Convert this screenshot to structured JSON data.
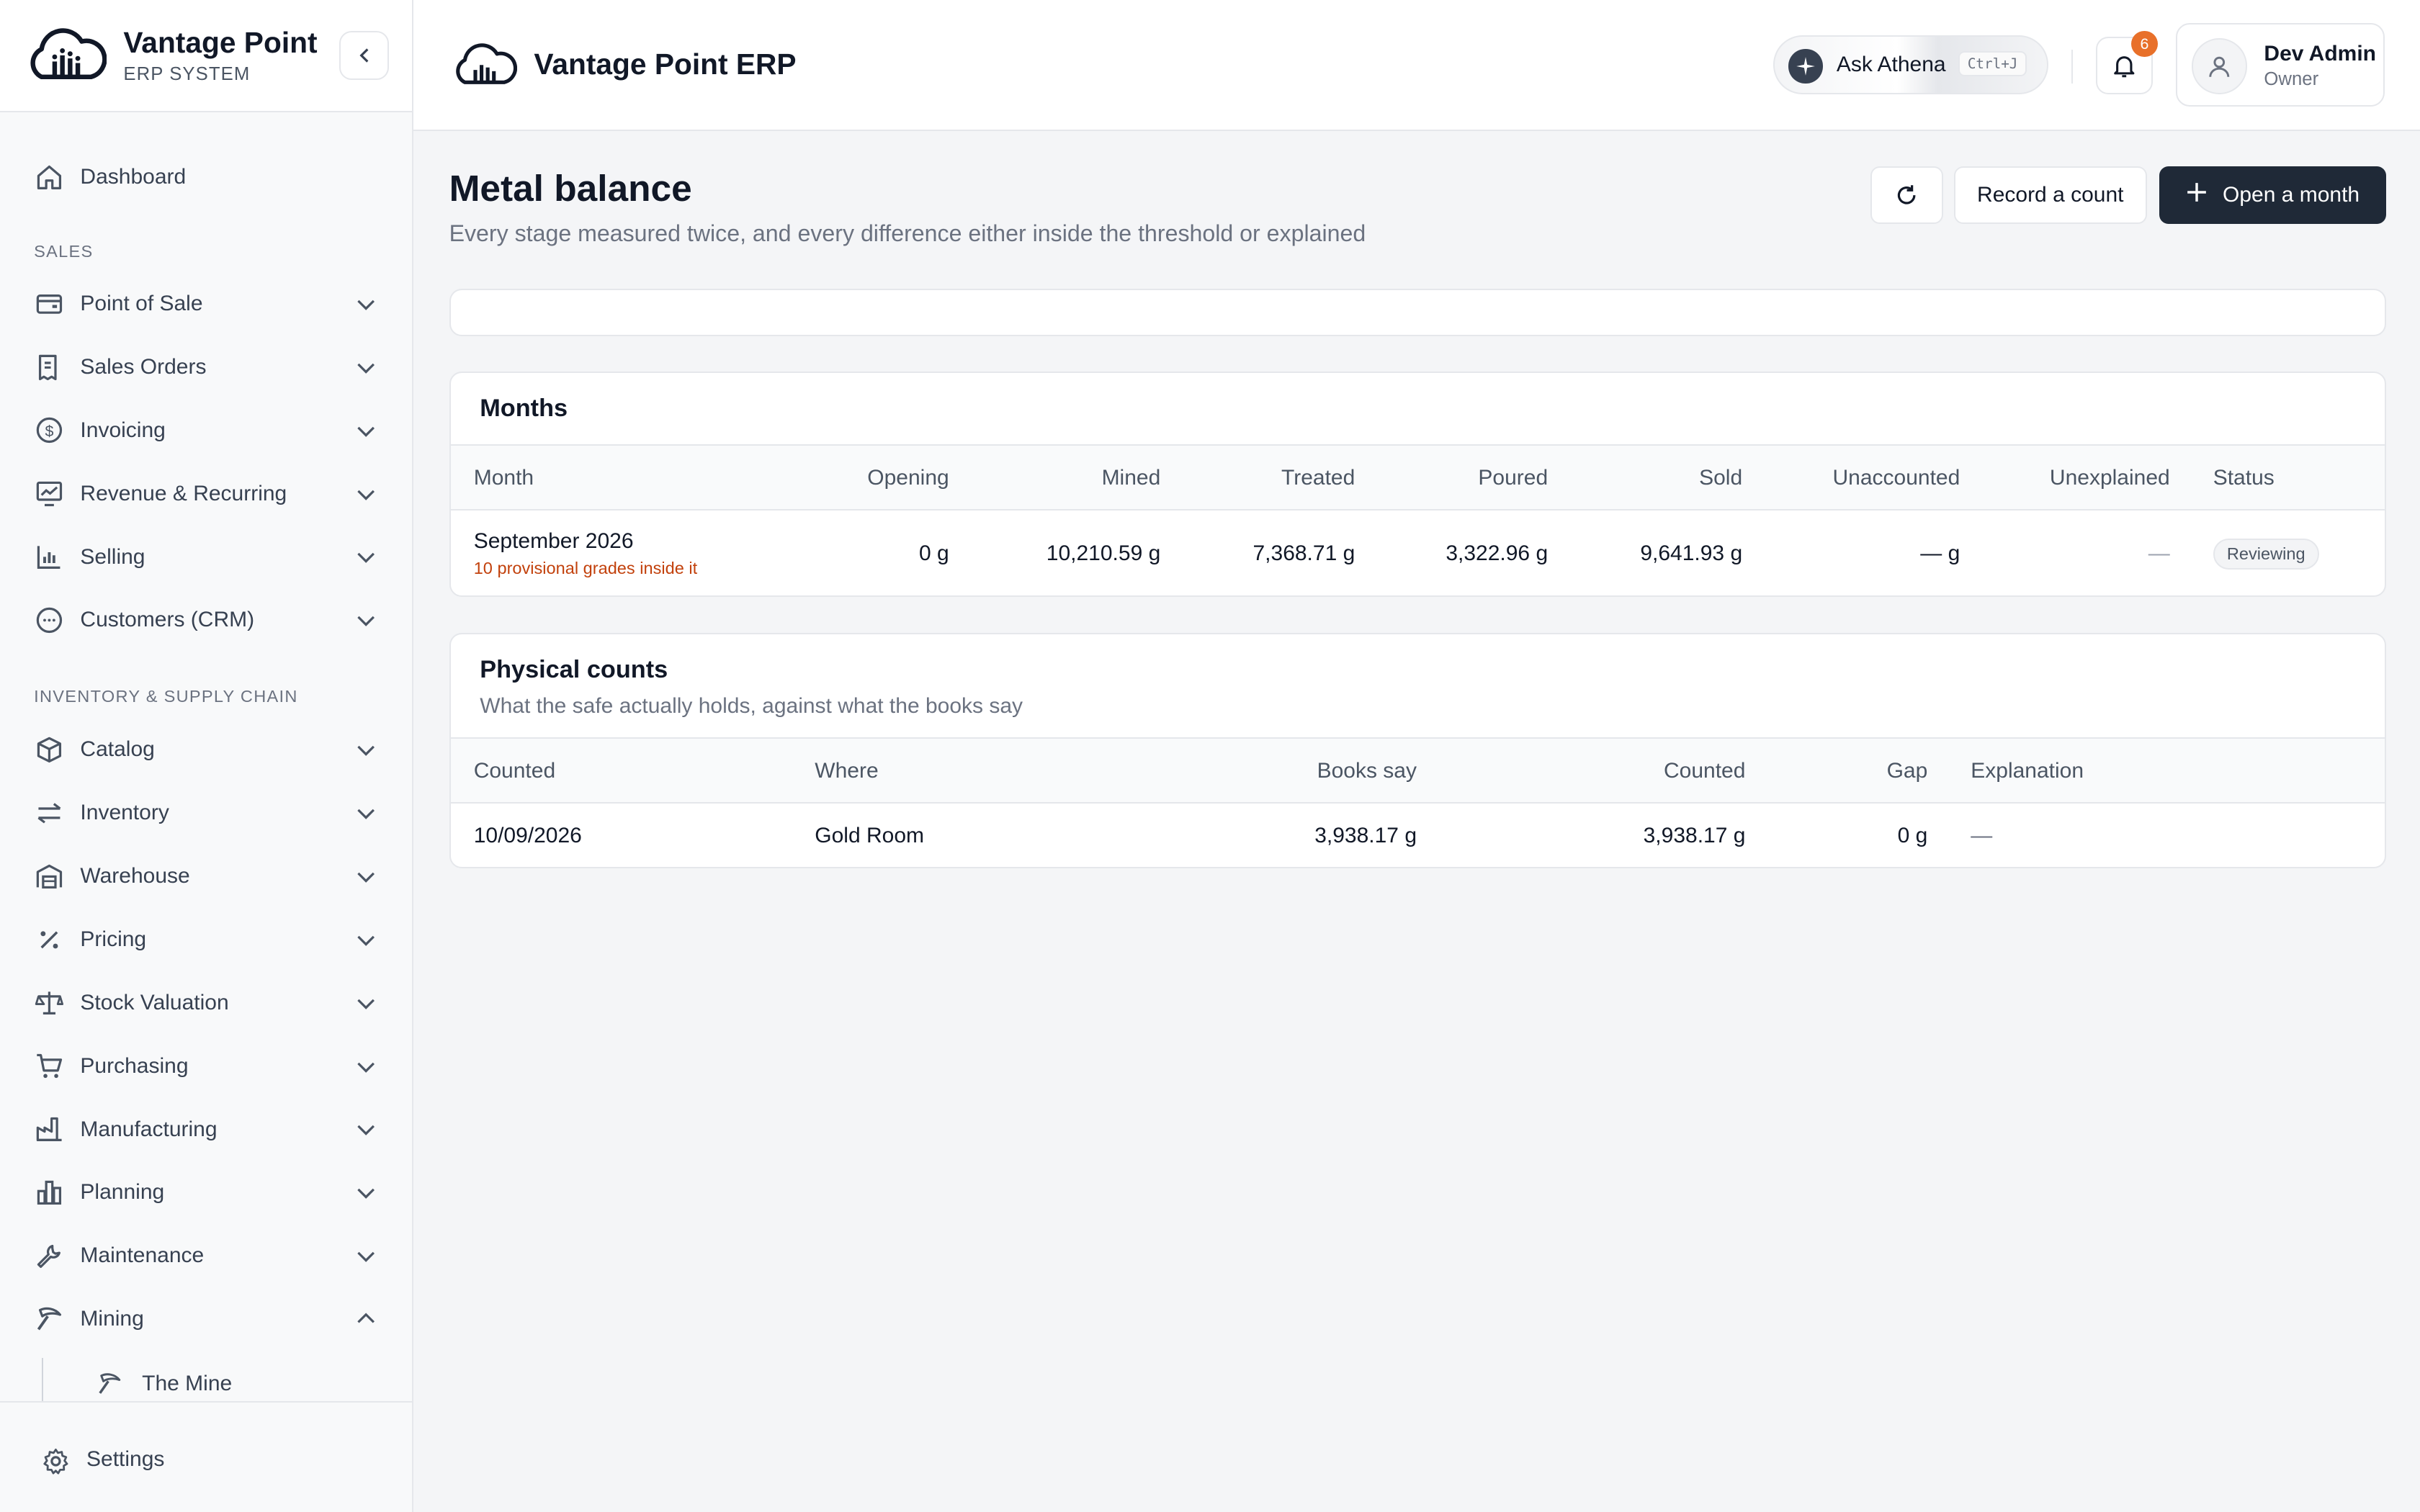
{
  "brand": {
    "name": "Vantage Point",
    "subtitle": "ERP SYSTEM"
  },
  "sidebar": {
    "dashboard": "Dashboard",
    "sections": {
      "sales": "SALES",
      "inventory": "INVENTORY & SUPPLY CHAIN"
    },
    "items": [
      {
        "label": "Point of Sale",
        "icon": "wallet-icon"
      },
      {
        "label": "Sales Orders",
        "icon": "receipt-icon"
      },
      {
        "label": "Invoicing",
        "icon": "dollar-circle-icon"
      },
      {
        "label": "Revenue & Recurring",
        "icon": "chart-line-icon"
      },
      {
        "label": "Selling",
        "icon": "bar-chart-icon"
      },
      {
        "label": "Customers (CRM)",
        "icon": "chat-icon"
      },
      {
        "label": "Catalog",
        "icon": "box-icon"
      },
      {
        "label": "Inventory",
        "icon": "arrows-icon"
      },
      {
        "label": "Warehouse",
        "icon": "warehouse-icon"
      },
      {
        "label": "Pricing",
        "icon": "percent-icon"
      },
      {
        "label": "Stock Valuation",
        "icon": "scale-icon"
      },
      {
        "label": "Purchasing",
        "icon": "cart-icon"
      },
      {
        "label": "Manufacturing",
        "icon": "factory-icon"
      },
      {
        "label": "Planning",
        "icon": "bars-icon"
      },
      {
        "label": "Maintenance",
        "icon": "wrench-icon"
      },
      {
        "label": "Mining",
        "icon": "pickaxe-icon"
      }
    ],
    "sub_item": "The Mine",
    "settings": "Settings"
  },
  "header": {
    "title": "Vantage Point ERP",
    "ask_label": "Ask Athena",
    "shortcut": "Ctrl+J",
    "notifications": "6",
    "user_name": "Dev Admin",
    "user_role": "Owner"
  },
  "page": {
    "title": "Metal balance",
    "subtitle": "Every stage measured twice, and every difference either inside the threshold or explained",
    "record_label": "Record a count",
    "open_label": "Open a month"
  },
  "months": {
    "title": "Months",
    "columns": [
      "Month",
      "Opening",
      "Mined",
      "Treated",
      "Poured",
      "Sold",
      "Unaccounted",
      "Unexplained",
      "Status"
    ],
    "rows": [
      {
        "month": "September 2026",
        "note": "10 provisional grades inside it",
        "opening": "0 g",
        "mined": "10,210.59 g",
        "treated": "7,368.71 g",
        "poured": "3,322.96 g",
        "sold": "9,641.93 g",
        "unaccounted": "— g",
        "unexplained": "—",
        "status": "Reviewing"
      }
    ]
  },
  "counts": {
    "title": "Physical counts",
    "subtitle": "What the safe actually holds, against what the books say",
    "columns": [
      "Counted",
      "Where",
      "Books say",
      "Counted",
      "Gap",
      "Explanation"
    ],
    "rows": [
      {
        "date": "10/09/2026",
        "where": "Gold Room",
        "books": "3,938.17 g",
        "counted": "3,938.17 g",
        "gap": "0 g",
        "explanation": "—"
      }
    ]
  },
  "colors": {
    "accent_dark": "#1f2937",
    "badge": "#e8702a",
    "provisional": "#c2410c"
  }
}
